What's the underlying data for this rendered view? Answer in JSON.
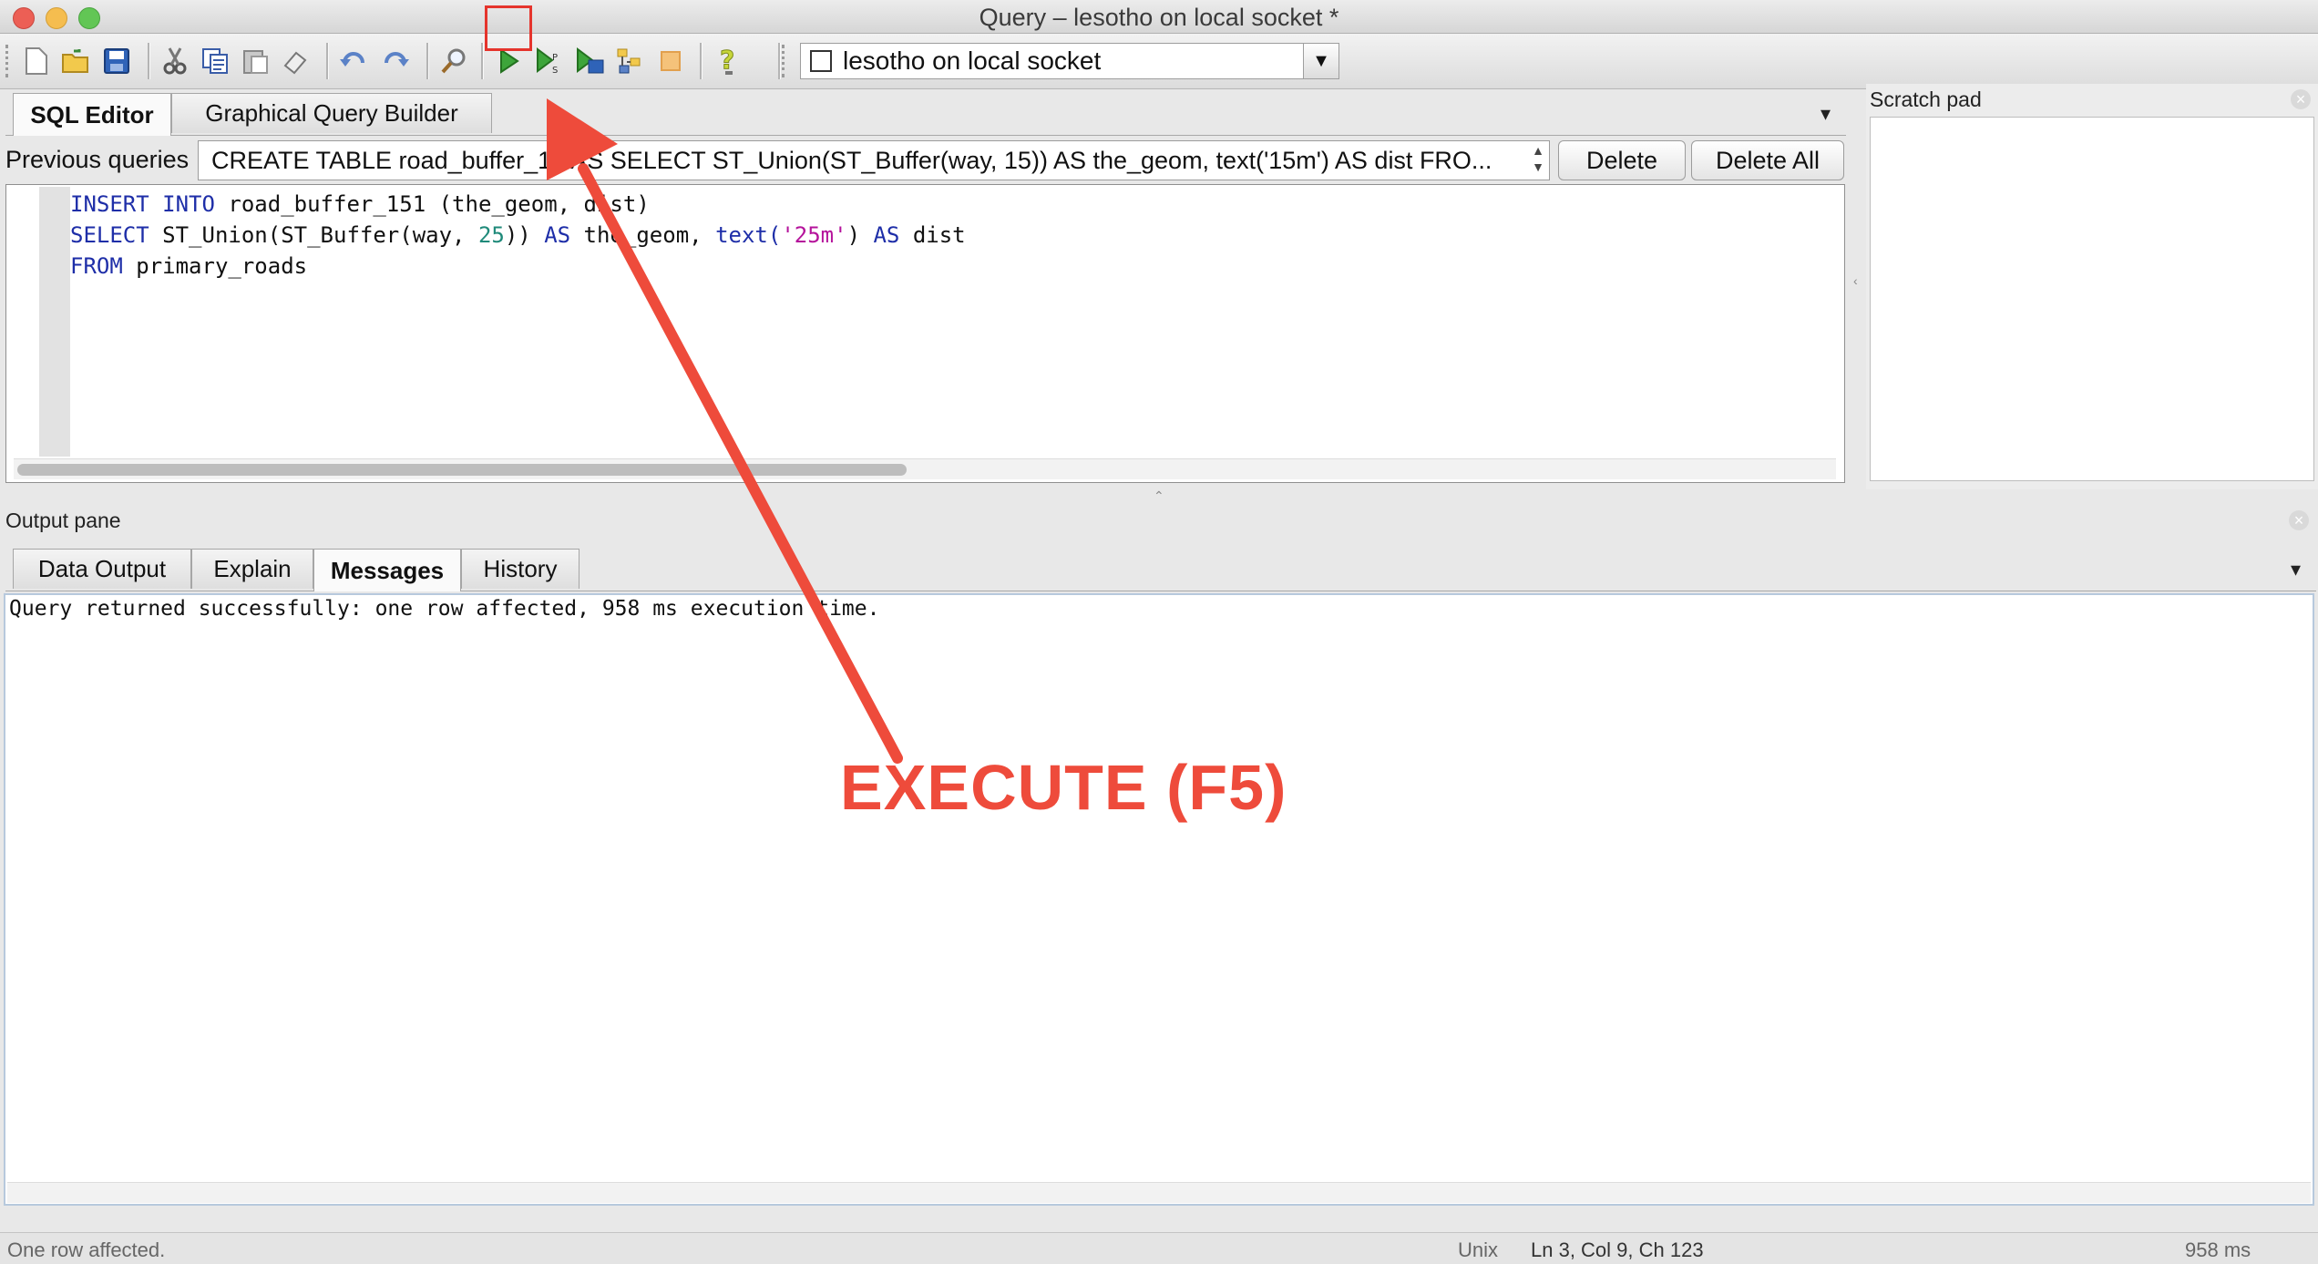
{
  "window": {
    "title": "Query – lesotho on local socket *"
  },
  "toolbar": {
    "icons": [
      "new-file-icon",
      "open-folder-icon",
      "save-icon",
      "cut-icon",
      "copy-icon",
      "paste-icon",
      "clear-icon",
      "undo-icon",
      "redo-icon",
      "find-icon",
      "execute-icon",
      "execute-pgscript-icon",
      "execute-to-file-icon",
      "explain-icon",
      "cancel-query-icon",
      "help-icon"
    ],
    "connection_label": "lesotho on local socket"
  },
  "editor_tabs": [
    {
      "label": "SQL Editor",
      "active": true
    },
    {
      "label": "Graphical Query Builder",
      "active": false
    }
  ],
  "previous_queries": {
    "label": "Previous queries",
    "selected": "CREATE TABLE road_buffer_15 AS SELECT ST_Union(ST_Buffer(way, 15)) AS the_geom, text('15m') AS dist FRO...",
    "delete_label": "Delete",
    "delete_all_label": "Delete All"
  },
  "editor": {
    "line1": {
      "kw1": "INSERT",
      "kw2": "INTO",
      "rest": "road_buffer_151 (the_geom, dist)"
    },
    "line2": {
      "kw1": "SELECT",
      "fn": "ST_Union(ST_Buffer(way, ",
      "num": "25",
      "mid": ")) ",
      "kw2": "AS",
      "mid2": " the_geom, ",
      "fn2": "text(",
      "str": "'25m'",
      "end": ") ",
      "kw3": "AS",
      "end2": " dist"
    },
    "line3": {
      "kw1": "FROM",
      "rest": "primary_roads"
    }
  },
  "scratch_pad": {
    "title": "Scratch pad"
  },
  "output_pane": {
    "title": "Output pane",
    "tabs": [
      {
        "label": "Data Output",
        "active": false
      },
      {
        "label": "Explain",
        "active": false
      },
      {
        "label": "Messages",
        "active": true
      },
      {
        "label": "History",
        "active": false
      }
    ],
    "message": "Query returned successfully: one row affected, 958 ms execution time."
  },
  "status_bar": {
    "left": "One row affected.",
    "line_ending": "Unix",
    "position": "Ln 3, Col 9, Ch 123",
    "time": "958 ms"
  },
  "annotation": {
    "text": "EXECUTE (F5)",
    "color": "#ee4b3b"
  }
}
